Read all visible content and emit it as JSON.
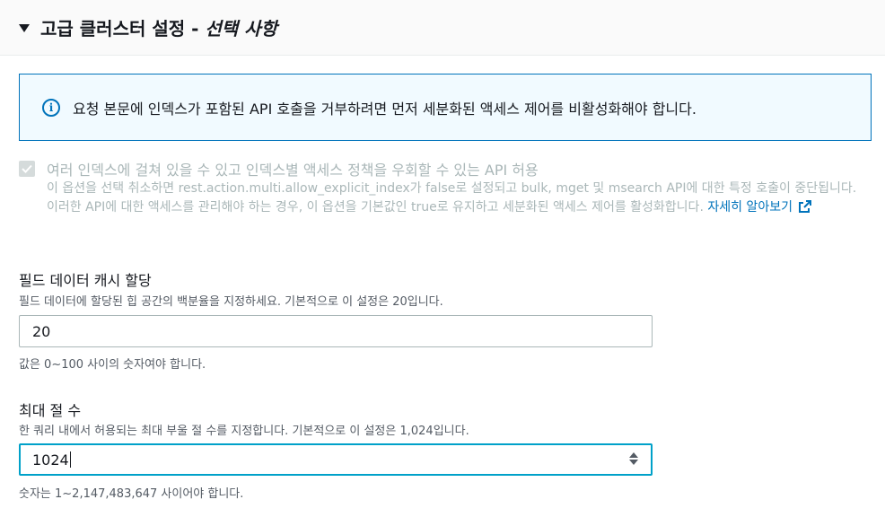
{
  "section": {
    "title": "고급 클러스터 설정",
    "separator": " - ",
    "optional": "선택 사항"
  },
  "alert": {
    "icon": "info-icon",
    "text": "요청 본문에 인덱스가 포함된 API 호출을 거부하려면 먼저 세분화된 액세스 제어를 비활성화해야 합니다."
  },
  "multi_index": {
    "checked": true,
    "disabled": true,
    "label": "여러 인덱스에 걸쳐 있을 수 있고 인덱스별 액세스 정책을 우회할 수 있는 API 허용",
    "description": "이 옵션을 선택 취소하면 rest.action.multi.allow_explicit_index가 false로 설정되고 bulk, mget 및 msearch API에 대한 특정 호출이 중단됩니다. 이러한 API에 대한 액세스를 관리해야 하는 경우, 이 옵션을 기본값인 true로 유지하고 세분화된 액세스 제어를 활성화합니다.",
    "learn_more": "자세히 알아보기",
    "learn_more_icon": "external-link-icon"
  },
  "fielddata": {
    "label": "필드 데이터 캐시 할당",
    "description": "필드 데이터에 할당된 힙 공간의 백분율을 지정하세요. 기본적으로 이 설정은 20입니다.",
    "value": "20",
    "hint": "값은 0~100 사이의 숫자여야 합니다."
  },
  "max_clause": {
    "label": "최대 절 수",
    "description": "한 쿼리 내에서 허용되는 최대 부울 절 수를 지정합니다. 기본적으로 이 설정은 1,024입니다.",
    "value": "1024",
    "hint": "숫자는 1~2,147,483,647 사이어야 합니다."
  },
  "colors": {
    "accent": "#0073bb",
    "focus": "#00a1c9",
    "alert_bg": "#f1faff",
    "disabled_text": "#aab7b8"
  }
}
